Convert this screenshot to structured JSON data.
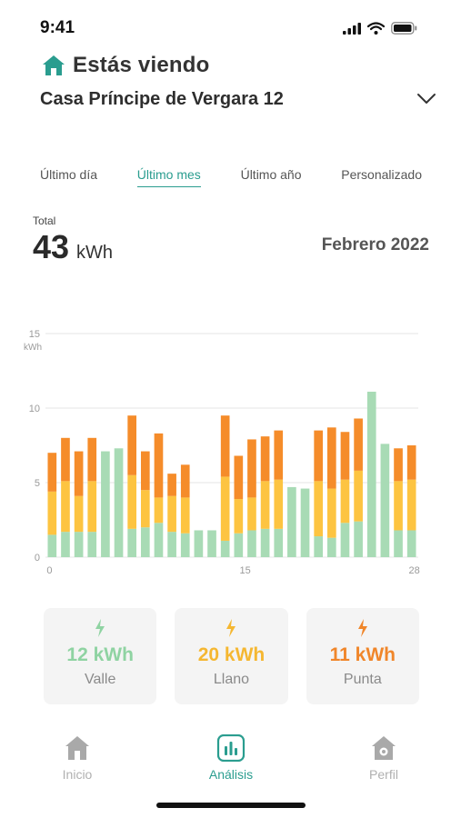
{
  "status_bar": {
    "time": "9:41"
  },
  "header": {
    "title": "Estás viendo",
    "location": "Casa Príncipe de Vergara 12"
  },
  "period_tabs": [
    {
      "label": "Último día"
    },
    {
      "label": "Último mes"
    },
    {
      "label": "Último año"
    },
    {
      "label": "Personalizado"
    }
  ],
  "summary": {
    "total_label": "Total",
    "total_value": "43",
    "total_unit": "kWh",
    "period": "Febrero 2022"
  },
  "colors": {
    "accent": "#2a9d8f",
    "valle": "#a8dbb5",
    "llano": "#fdc441",
    "punta": "#f58c2a",
    "text_valle": "#8fd3a2",
    "text_llano": "#f5b731",
    "text_punta": "#f0862a"
  },
  "chart_data": {
    "type": "bar",
    "stacked": true,
    "ylabel": "kWh",
    "ylim": [
      0,
      15
    ],
    "y_ticks": [
      "0",
      "5",
      "10",
      "15"
    ],
    "x_ticks": [
      "0",
      "15",
      "28"
    ],
    "grid": true,
    "series": [
      {
        "name": "Valle",
        "values": [
          1.5,
          1.7,
          1.7,
          1.7,
          7.1,
          7.3,
          1.9,
          2.0,
          2.3,
          1.7,
          1.6,
          1.8,
          1.8,
          1.1,
          1.6,
          1.8,
          1.9,
          1.9,
          4.7,
          4.6,
          1.4,
          1.3,
          2.3,
          2.4,
          11.1,
          7.6,
          1.8,
          1.8
        ]
      },
      {
        "name": "Llano",
        "values": [
          2.9,
          3.4,
          2.4,
          3.4,
          0,
          0,
          3.6,
          2.5,
          1.7,
          2.4,
          2.4,
          0,
          0,
          4.3,
          2.3,
          2.2,
          3.2,
          3.3,
          0,
          0,
          3.7,
          3.3,
          2.9,
          3.4,
          0,
          0,
          3.3,
          3.4
        ]
      },
      {
        "name": "Punta",
        "values": [
          2.6,
          2.9,
          3.0,
          2.9,
          0,
          0,
          4.0,
          2.6,
          4.3,
          1.5,
          2.2,
          0,
          0,
          4.1,
          2.9,
          3.9,
          3.0,
          3.3,
          0,
          0,
          3.4,
          4.1,
          3.2,
          3.5,
          0,
          0,
          2.2,
          2.3
        ]
      }
    ]
  },
  "tariffs": [
    {
      "value": "12 kWh",
      "label": "Valle"
    },
    {
      "value": "20 kWh",
      "label": "Llano"
    },
    {
      "value": "11 kWh",
      "label": "Punta"
    }
  ],
  "nav": [
    {
      "label": "Inicio"
    },
    {
      "label": "Análisis"
    },
    {
      "label": "Perfil"
    }
  ]
}
